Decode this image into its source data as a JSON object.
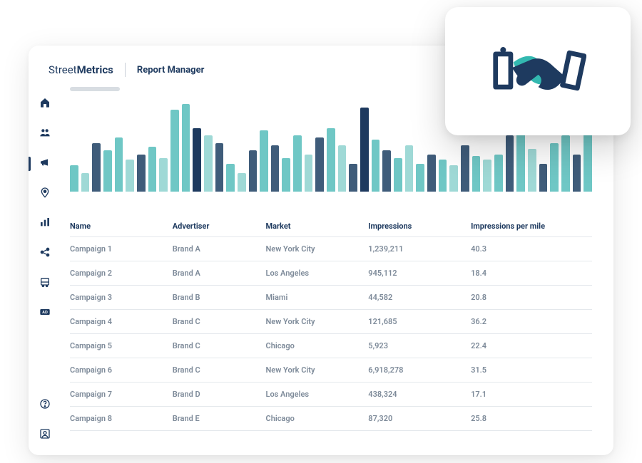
{
  "brand": {
    "light": "Street",
    "bold": "Metrics"
  },
  "page_title": "Report Manager",
  "colors": {
    "dark": "#1e3a5f",
    "teal1": "#6fc7c5",
    "teal2": "#9fd9d6",
    "navy": "#3f5c7a",
    "grey": "#c9d0d8"
  },
  "sidebar": {
    "items": [
      {
        "icon": "home",
        "active": false
      },
      {
        "icon": "people",
        "active": false
      },
      {
        "icon": "megaphone",
        "active": true
      },
      {
        "icon": "location",
        "active": false
      },
      {
        "icon": "bar-chart",
        "active": false
      },
      {
        "icon": "share",
        "active": false
      },
      {
        "icon": "bus",
        "active": false
      },
      {
        "icon": "ad",
        "active": false
      }
    ],
    "bottom": [
      {
        "icon": "help"
      },
      {
        "icon": "user"
      }
    ]
  },
  "chart_data": {
    "type": "bar",
    "title": "",
    "xlabel": "",
    "ylabel": "",
    "ylim": [
      0,
      100
    ],
    "series_colors": [
      "#6fc7c5",
      "#9fd9d6",
      "#3f5c7a",
      "#1e3a5f"
    ],
    "bars": [
      {
        "h": 28,
        "c": 0
      },
      {
        "h": 20,
        "c": 1
      },
      {
        "h": 52,
        "c": 2
      },
      {
        "h": 44,
        "c": 0
      },
      {
        "h": 58,
        "c": 0
      },
      {
        "h": 34,
        "c": 1
      },
      {
        "h": 40,
        "c": 2
      },
      {
        "h": 48,
        "c": 0
      },
      {
        "h": 36,
        "c": 1
      },
      {
        "h": 88,
        "c": 0
      },
      {
        "h": 94,
        "c": 0
      },
      {
        "h": 68,
        "c": 3
      },
      {
        "h": 60,
        "c": 1
      },
      {
        "h": 52,
        "c": 2
      },
      {
        "h": 30,
        "c": 0
      },
      {
        "h": 20,
        "c": 1
      },
      {
        "h": 44,
        "c": 2
      },
      {
        "h": 66,
        "c": 0
      },
      {
        "h": 50,
        "c": 2
      },
      {
        "h": 36,
        "c": 0
      },
      {
        "h": 60,
        "c": 0
      },
      {
        "h": 40,
        "c": 1
      },
      {
        "h": 58,
        "c": 2
      },
      {
        "h": 68,
        "c": 0
      },
      {
        "h": 50,
        "c": 1
      },
      {
        "h": 30,
        "c": 2
      },
      {
        "h": 90,
        "c": 3
      },
      {
        "h": 56,
        "c": 0
      },
      {
        "h": 44,
        "c": 2
      },
      {
        "h": 36,
        "c": 0
      },
      {
        "h": 50,
        "c": 1
      },
      {
        "h": 30,
        "c": 0
      },
      {
        "h": 40,
        "c": 2
      },
      {
        "h": 34,
        "c": 0
      },
      {
        "h": 28,
        "c": 1
      },
      {
        "h": 50,
        "c": 2
      },
      {
        "h": 38,
        "c": 0
      },
      {
        "h": 34,
        "c": 1
      },
      {
        "h": 40,
        "c": 0
      },
      {
        "h": 60,
        "c": 2
      },
      {
        "h": 64,
        "c": 0
      },
      {
        "h": 46,
        "c": 1
      },
      {
        "h": 30,
        "c": 2
      },
      {
        "h": 52,
        "c": 0
      },
      {
        "h": 60,
        "c": 0
      },
      {
        "h": 40,
        "c": 2
      },
      {
        "h": 70,
        "c": 0
      }
    ]
  },
  "table": {
    "headers": [
      "Name",
      "Advertiser",
      "Market",
      "Impressions",
      "Impressions per mile"
    ],
    "rows": [
      [
        "Campaign 1",
        "Brand A",
        "New York City",
        "1,239,211",
        "40.3"
      ],
      [
        "Campaign 2",
        "Brand A",
        "Los Angeles",
        "945,112",
        "18.4"
      ],
      [
        "Campaign 3",
        "Brand B",
        "Miami",
        "44,582",
        "20.8"
      ],
      [
        "Campaign 4",
        "Brand C",
        "New York City",
        "121,685",
        "36.2"
      ],
      [
        "Campaign 5",
        "Brand C",
        "Chicago",
        "5,923",
        "22.4"
      ],
      [
        "Campaign 6",
        "Brand C",
        "New York City",
        "6,918,278",
        "31.5"
      ],
      [
        "Campaign 7",
        "Brand D",
        "Los Angeles",
        "438,324",
        "17.1"
      ],
      [
        "Campaign 8",
        "Brand E",
        "Chicago",
        "87,320",
        "25.8"
      ]
    ]
  }
}
